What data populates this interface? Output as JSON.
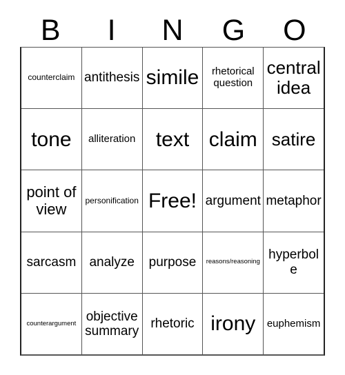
{
  "card": {
    "title": "BINGO",
    "header_letters": [
      "B",
      "I",
      "N",
      "G",
      "O"
    ],
    "columns": 5,
    "rows": 5,
    "free_space": {
      "row": 2,
      "col": 2,
      "label": "Free!"
    },
    "colors": {
      "background": "#ffffff",
      "text": "#000000",
      "grid_line": "#555555",
      "outer_border": "#222222"
    },
    "rows_data": [
      [
        {
          "text": "counterclaim",
          "size": "fs-xs"
        },
        {
          "text": "antithesis",
          "size": "fs-m"
        },
        {
          "text": "simile",
          "size": "fs-xxl"
        },
        {
          "text": "rhetorical question",
          "size": "fs-s"
        },
        {
          "text": "central idea",
          "size": "fs-xl"
        }
      ],
      [
        {
          "text": "tone",
          "size": "fs-xxl"
        },
        {
          "text": "alliteration",
          "size": "fs-s"
        },
        {
          "text": "text",
          "size": "fs-xxl"
        },
        {
          "text": "claim",
          "size": "fs-xxl"
        },
        {
          "text": "satire",
          "size": "fs-xl"
        }
      ],
      [
        {
          "text": "point of view",
          "size": "fs-l"
        },
        {
          "text": "personification",
          "size": "fs-xs"
        },
        {
          "text": "Free!",
          "size": "fs-xxl"
        },
        {
          "text": "argument",
          "size": "fs-m"
        },
        {
          "text": "metaphor",
          "size": "fs-m"
        }
      ],
      [
        {
          "text": "sarcasm",
          "size": "fs-m"
        },
        {
          "text": "analyze",
          "size": "fs-m"
        },
        {
          "text": "purpose",
          "size": "fs-m"
        },
        {
          "text": "reasons/reasoning",
          "size": "fs-xxs"
        },
        {
          "text": "hyperbole",
          "size": "fs-m"
        }
      ],
      [
        {
          "text": "counterargument",
          "size": "fs-xxs"
        },
        {
          "text": "objective summary",
          "size": "fs-m"
        },
        {
          "text": "rhetoric",
          "size": "fs-m"
        },
        {
          "text": "irony",
          "size": "fs-xxl"
        },
        {
          "text": "euphemism",
          "size": "fs-s"
        }
      ]
    ]
  }
}
